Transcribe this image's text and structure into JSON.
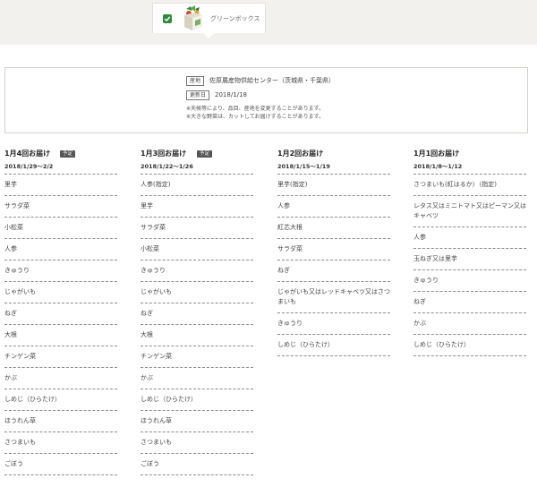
{
  "product": {
    "name": "グリーンボックス",
    "checked": true,
    "icon": "vegetable-box-icon",
    "accent_color": "#2f8a3e"
  },
  "info": {
    "origin_label": "産地",
    "origin_value": "佐原農産物供給センター（茨城県・千葉県）",
    "updated_label": "更新日",
    "updated_value": "2018/1/18",
    "notes": [
      "※天候等により、品目、産地を変更することがあります。",
      "※大きな野菜は、カットしてお届けすることがあります。"
    ]
  },
  "columns": [
    {
      "title": "1月4回お届け",
      "badge": "予定",
      "date": "2018/1/29〜2/2",
      "items": [
        "里芋",
        "サラダ菜",
        "小松菜",
        "人参",
        "きゅうり",
        "じゃがいも",
        "ねぎ",
        "大根",
        "チンゲン菜",
        "かぶ",
        "しめじ（ひらたけ）",
        "ほうれん草",
        "さつまいも",
        "ごぼう"
      ]
    },
    {
      "title": "1月3回お届け",
      "badge": "予定",
      "date": "2018/1/22〜1/26",
      "items": [
        "人参(指定)",
        "里芋",
        "サラダ菜",
        "小松菜",
        "きゅうり",
        "じゃがいも",
        "ねぎ",
        "大根",
        "チンゲン菜",
        "かぶ",
        "しめじ（ひらたけ）",
        "ほうれん草",
        "さつまいも",
        "ごぼう"
      ]
    },
    {
      "title": "1月2回お届け",
      "badge": "",
      "date": "2018/1/15〜1/19",
      "items": [
        "里芋(指定)",
        "人参",
        "紅芯大根",
        "サラダ菜",
        "ねぎ",
        "じゃがいも又はレッドキャベツ又はさつまいも",
        "きゅうり",
        "しめじ（ひらたけ）"
      ]
    },
    {
      "title": "1月1回お届け",
      "badge": "",
      "date": "2018/1/8〜1/12",
      "items": [
        "さつまいも(紅はるか）（指定)",
        "レタス又はミニトマト又はピーマン又はキャベツ",
        "人参",
        "玉ねぎ又は里芋",
        "きゅうり",
        "ねぎ",
        "かぶ",
        "しめじ（ひらたけ）"
      ]
    }
  ]
}
